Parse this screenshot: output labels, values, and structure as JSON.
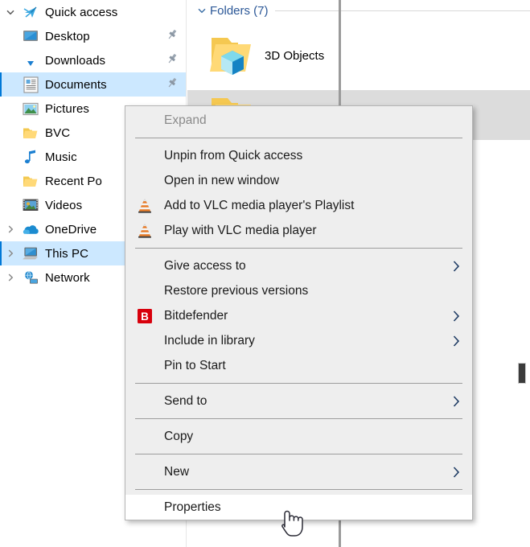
{
  "nav_pane": {
    "items": [
      {
        "label": "Quick access",
        "icon": "star-pin-icon",
        "expander": "chevron-down",
        "level": 0,
        "selected": false,
        "pinned": false
      },
      {
        "label": "Desktop",
        "icon": "desktop-icon",
        "expander": "none",
        "level": 1,
        "selected": false,
        "pinned": true
      },
      {
        "label": "Downloads",
        "icon": "downloads-arrow-icon",
        "expander": "none",
        "level": 1,
        "selected": false,
        "pinned": true
      },
      {
        "label": "Documents",
        "icon": "documents-icon",
        "expander": "none",
        "level": 1,
        "selected": true,
        "pinned": true
      },
      {
        "label": "Pictures",
        "icon": "pictures-icon",
        "expander": "none",
        "level": 1,
        "selected": false,
        "pinned": false
      },
      {
        "label": "BVC",
        "icon": "folder-icon",
        "expander": "none",
        "level": 1,
        "selected": false,
        "pinned": false
      },
      {
        "label": "Music",
        "icon": "music-note-icon",
        "expander": "none",
        "level": 1,
        "selected": false,
        "pinned": false
      },
      {
        "label": "Recent Po",
        "icon": "folder-icon",
        "expander": "none",
        "level": 1,
        "selected": false,
        "pinned": false
      },
      {
        "label": "Videos",
        "icon": "videos-filmstrip-icon",
        "expander": "none",
        "level": 1,
        "selected": false,
        "pinned": false
      },
      {
        "label": "OneDrive",
        "icon": "onedrive-cloud-icon",
        "expander": "chevron-right",
        "level": 0,
        "selected": false,
        "pinned": false
      },
      {
        "label": "This PC",
        "icon": "this-pc-icon",
        "expander": "chevron-right",
        "level": 0,
        "selected": true,
        "pinned": false
      },
      {
        "label": "Network",
        "icon": "network-icon",
        "expander": "chevron-right",
        "level": 0,
        "selected": false,
        "pinned": false
      }
    ]
  },
  "content": {
    "group_header": "Folders (7)",
    "items": [
      {
        "name": "3D Objects",
        "icon": "folder-3d-objects-icon",
        "selected": false
      },
      {
        "name": "",
        "icon": "folder-icon",
        "selected": true
      }
    ]
  },
  "context_menu": {
    "items": [
      {
        "label": "Expand",
        "icon": "none",
        "arrow": false,
        "disabled": true,
        "hover": false,
        "separator_after": true
      },
      {
        "label": "Unpin from Quick access",
        "icon": "none",
        "arrow": false,
        "disabled": false,
        "hover": false,
        "separator_after": false
      },
      {
        "label": "Open in new window",
        "icon": "none",
        "arrow": false,
        "disabled": false,
        "hover": false,
        "separator_after": false
      },
      {
        "label": "Add to VLC media player's Playlist",
        "icon": "vlc-cone-icon",
        "arrow": false,
        "disabled": false,
        "hover": false,
        "separator_after": false
      },
      {
        "label": "Play with VLC media player",
        "icon": "vlc-cone-icon",
        "arrow": false,
        "disabled": false,
        "hover": false,
        "separator_after": true
      },
      {
        "label": "Give access to",
        "icon": "none",
        "arrow": true,
        "disabled": false,
        "hover": false,
        "separator_after": false
      },
      {
        "label": "Restore previous versions",
        "icon": "none",
        "arrow": false,
        "disabled": false,
        "hover": false,
        "separator_after": false
      },
      {
        "label": "Bitdefender",
        "icon": "bitdefender-icon",
        "arrow": true,
        "disabled": false,
        "hover": false,
        "separator_after": false
      },
      {
        "label": "Include in library",
        "icon": "none",
        "arrow": true,
        "disabled": false,
        "hover": false,
        "separator_after": false
      },
      {
        "label": "Pin to Start",
        "icon": "none",
        "arrow": false,
        "disabled": false,
        "hover": false,
        "separator_after": true
      },
      {
        "label": "Send to",
        "icon": "none",
        "arrow": true,
        "disabled": false,
        "hover": false,
        "separator_after": true
      },
      {
        "label": "Copy",
        "icon": "none",
        "arrow": false,
        "disabled": false,
        "hover": false,
        "separator_after": true
      },
      {
        "label": "New",
        "icon": "none",
        "arrow": true,
        "disabled": false,
        "hover": false,
        "separator_after": true
      },
      {
        "label": "Properties",
        "icon": "none",
        "arrow": false,
        "disabled": false,
        "hover": true,
        "separator_after": false
      }
    ]
  },
  "cursor": {
    "type": "hand-pointer-cursor"
  },
  "colors": {
    "selection_blue": "#cce8ff",
    "selection_accent": "#0078d7",
    "menu_background": "#eeeeee",
    "menu_hover": "#ffffff",
    "group_header_blue": "#2b5797",
    "bitdefender_red": "#d8000c",
    "vlc_orange": "#e8751a",
    "disabled_text": "#8a8a8a"
  }
}
